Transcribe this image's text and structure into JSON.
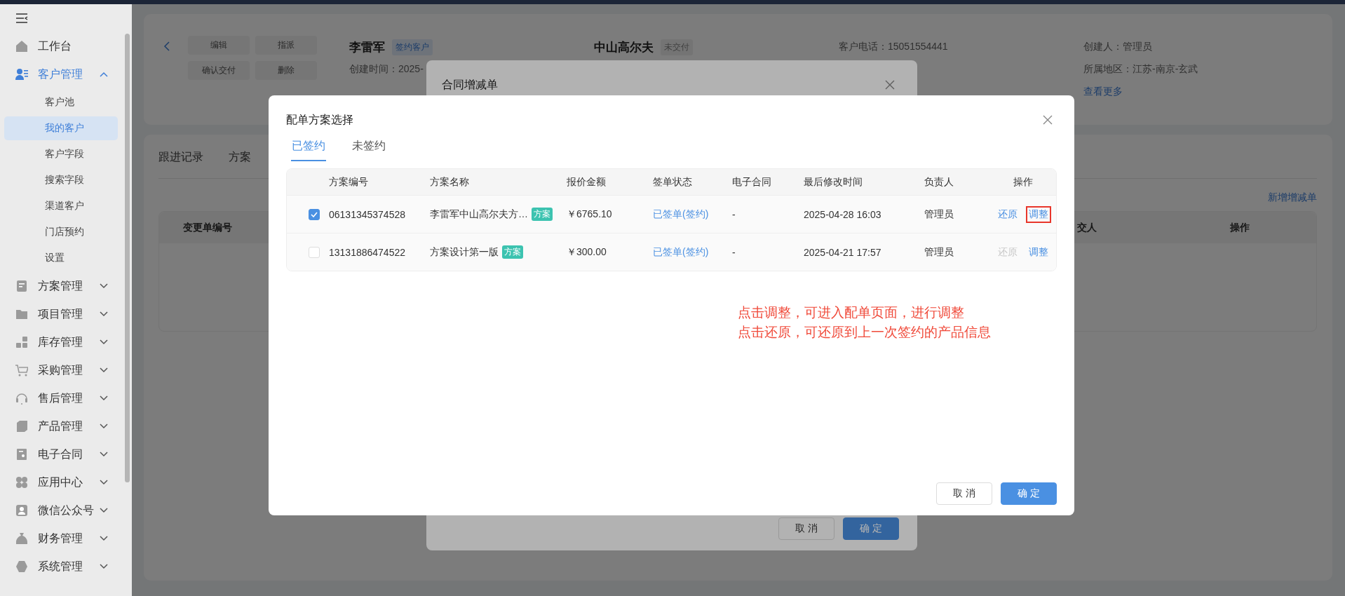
{
  "sidebar": {
    "items": [
      {
        "label": "工作台",
        "kind": "home"
      },
      {
        "label": "客户管理",
        "kind": "user",
        "expanded": true,
        "children": [
          {
            "label": "客户池",
            "selected": false
          },
          {
            "label": "我的客户",
            "selected": true
          },
          {
            "label": "客户字段",
            "selected": false
          },
          {
            "label": "搜索字段",
            "selected": false
          },
          {
            "label": "渠道客户",
            "selected": false
          },
          {
            "label": "门店预约",
            "selected": false
          },
          {
            "label": "设置",
            "selected": false
          }
        ]
      },
      {
        "label": "方案管理",
        "kind": "doc",
        "expanded": false
      },
      {
        "label": "项目管理",
        "kind": "folder",
        "expanded": false
      },
      {
        "label": "库存管理",
        "kind": "blocks",
        "expanded": false
      },
      {
        "label": "采购管理",
        "kind": "cart",
        "expanded": false
      },
      {
        "label": "售后管理",
        "kind": "headset",
        "expanded": false
      },
      {
        "label": "产品管理",
        "kind": "box",
        "expanded": false
      },
      {
        "label": "电子合同",
        "kind": "contract",
        "expanded": false
      },
      {
        "label": "应用中心",
        "kind": "apps",
        "expanded": false
      },
      {
        "label": "微信公众号",
        "kind": "person",
        "expanded": false
      },
      {
        "label": "财务管理",
        "kind": "bag",
        "expanded": false
      },
      {
        "label": "系统管理",
        "kind": "gear",
        "expanded": false
      }
    ]
  },
  "customer": {
    "actions": [
      "编辑",
      "指派",
      "确认交付",
      "删除"
    ],
    "name": "李雷军",
    "tag": "签约客户",
    "created": "创建时间：2025-",
    "project": "中山高尔夫",
    "project_status": "未交付",
    "phone": "客户电话：15051554441",
    "creator": "创建人：管理员",
    "region": "所属地区：江苏-南京-玄武",
    "more": "查看更多"
  },
  "detail": {
    "tabs": [
      "跟进记录",
      "方案"
    ],
    "add_link": "新增增减单",
    "columns": [
      "变更单编号",
      "交人",
      "操作"
    ]
  },
  "contract_modal": {
    "title": "合同增减单",
    "buttons": [
      {
        "label": "取 消",
        "kind": "secondary"
      },
      {
        "label": "确 定",
        "kind": "primary"
      }
    ]
  },
  "plan_modal": {
    "title": "配单方案选择",
    "tabs": [
      {
        "label": "已签约",
        "selected": true
      },
      {
        "label": "未签约",
        "selected": false
      }
    ],
    "columns": [
      "",
      "方案编号",
      "方案名称",
      "报价金额",
      "签单状态",
      "电子合同",
      "最后修改时间",
      "负责人",
      "操作"
    ],
    "rows": [
      {
        "checked": true,
        "code": "06131345374528",
        "name": "李雷军中山高尔夫方…",
        "tag": "方案",
        "amount": "￥6765.10",
        "status": "已签单(签约)",
        "econtract": "-",
        "time": "2025-04-28 16:03",
        "owner": "管理员",
        "actions": [
          {
            "label": "还原",
            "disabled": false,
            "highlighted": false
          },
          {
            "label": "调整",
            "disabled": false,
            "highlighted": true
          }
        ]
      },
      {
        "checked": false,
        "code": "13131886474522",
        "name": "方案设计第一版",
        "tag": "方案",
        "amount": "￥300.00",
        "status": "已签单(签约)",
        "econtract": "-",
        "time": "2025-04-21 17:57",
        "owner": "管理员",
        "actions": [
          {
            "label": "还原",
            "disabled": true,
            "highlighted": false
          },
          {
            "label": "调整",
            "disabled": false,
            "highlighted": false
          }
        ]
      }
    ],
    "note": [
      "点击调整，可进入配单页面，进行调整",
      "点击还原，可还原到上一次签约的产品信息"
    ],
    "buttons": [
      {
        "label": "取 消",
        "kind": "secondary"
      },
      {
        "label": "确 定",
        "kind": "primary"
      }
    ]
  }
}
